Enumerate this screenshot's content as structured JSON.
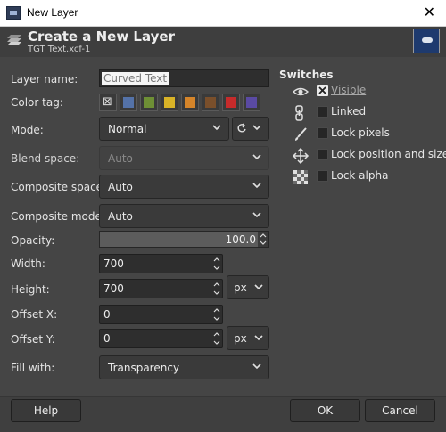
{
  "window": {
    "title": "New Layer",
    "close_glyph": "✕"
  },
  "header": {
    "title": "Create a New Layer",
    "subtitle": "TGT Text.xcf-1"
  },
  "form": {
    "layer_name": {
      "label": "Layer name:",
      "value": "Curved Text"
    },
    "color_tag": {
      "label": "Color tag:",
      "none_glyph": "⊠",
      "colors": [
        "#5472a8",
        "#6e8f35",
        "#d9b327",
        "#d5852a",
        "#7a4f2b",
        "#c62b2b",
        "#5a4aa3",
        "#7b7b7b"
      ]
    },
    "mode": {
      "label": "Mode:",
      "value": "Normal"
    },
    "blend_space": {
      "label": "Blend space:",
      "value": "Auto"
    },
    "composite_space": {
      "label": "Composite space:",
      "value": "Auto"
    },
    "composite_mode": {
      "label": "Composite mode:",
      "value": "Auto"
    },
    "opacity": {
      "label": "Opacity:",
      "value": "100.0",
      "level": 100
    },
    "width": {
      "label": "Width:",
      "value": "700"
    },
    "height": {
      "label": "Height:",
      "value": "700"
    },
    "size_unit": "px",
    "offset_x": {
      "label": "Offset X:",
      "value": "0"
    },
    "offset_y": {
      "label": "Offset Y:",
      "value": "0"
    },
    "offset_unit": "px",
    "fill_with": {
      "label": "Fill with:",
      "value": "Transparency"
    }
  },
  "switches": {
    "title": "Switches",
    "items": [
      {
        "label": "Visible",
        "icon": "eye-icon",
        "checked": true
      },
      {
        "label": "Linked",
        "icon": "chain-link-icon",
        "checked": false
      },
      {
        "label": "Lock pixels",
        "icon": "brush-icon",
        "checked": false
      },
      {
        "label": "Lock position and size",
        "icon": "move-arrows-icon",
        "checked": false
      },
      {
        "label": "Lock alpha",
        "icon": "checkerboard-icon",
        "checked": false
      }
    ]
  },
  "buttons": {
    "help": "Help",
    "ok": "OK",
    "cancel": "Cancel"
  },
  "colors": {
    "dialog_bg": "#454545",
    "field_bg": "#2e2e2e",
    "opacity_bar": "#5c5c5c"
  }
}
